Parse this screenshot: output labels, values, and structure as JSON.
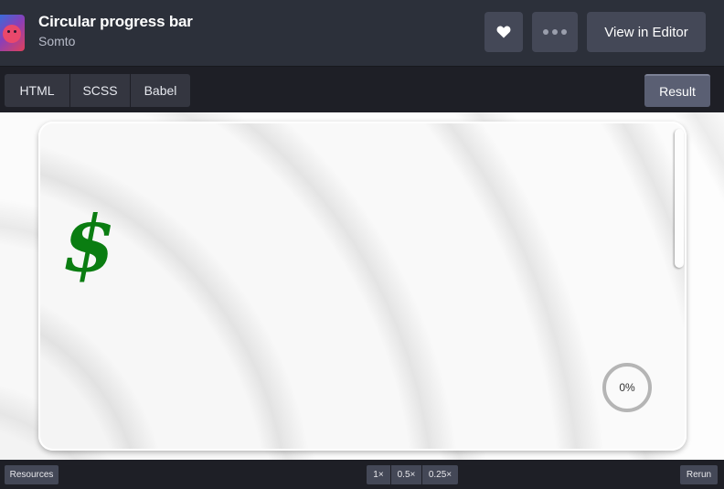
{
  "header": {
    "title": "Circular progress bar",
    "author": "Somto",
    "editor_button": "View in Editor"
  },
  "tabs": {
    "html": "HTML",
    "scss": "SCSS",
    "babel": "Babel",
    "result": "Result"
  },
  "preview": {
    "symbol": "$",
    "progress_label": "0%",
    "progress_value": 0
  },
  "footer": {
    "resources": "Resources",
    "zoom_options": [
      "1×",
      "0.5×",
      "0.25×"
    ],
    "rerun": "Rerun"
  },
  "colors": {
    "header_bg": "#2c303a",
    "button_bg": "#444857",
    "dollar_green": "#0a7d11"
  },
  "icons": {
    "avatar": "avatar-illustration",
    "heart": "heart-icon",
    "more": "more-dots-icon"
  }
}
